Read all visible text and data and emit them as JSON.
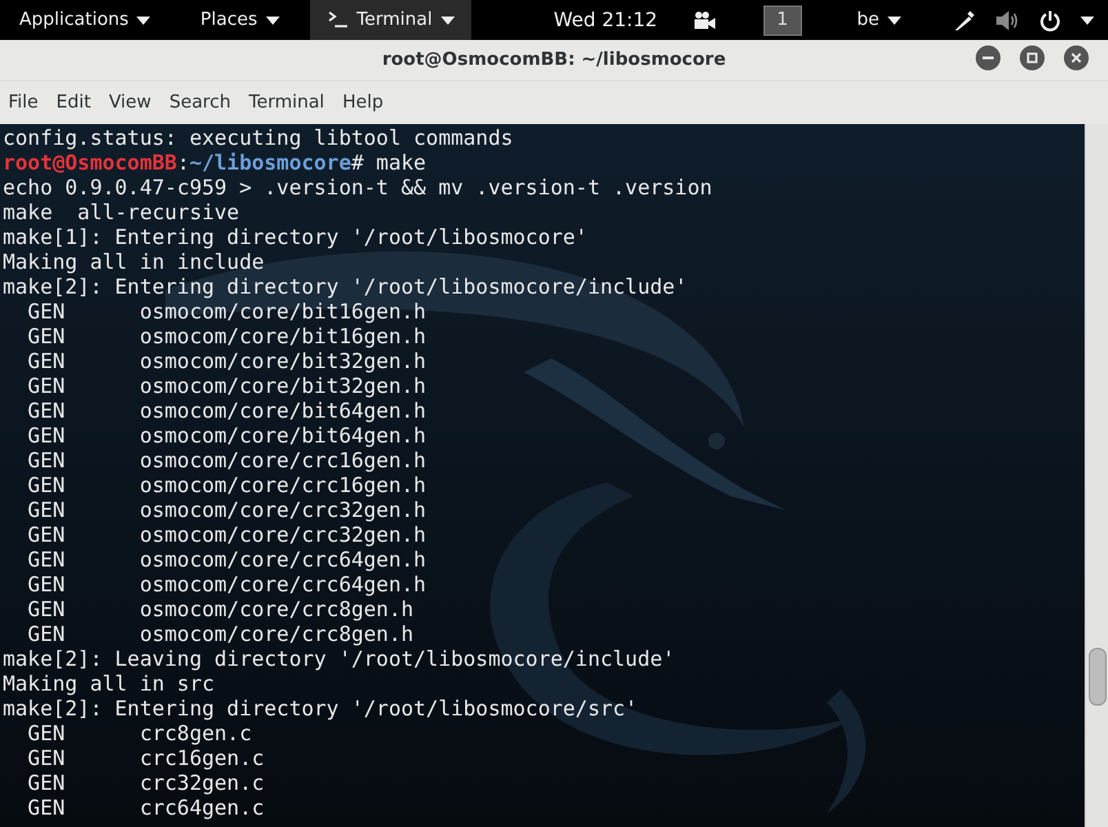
{
  "top_bar": {
    "menus": [
      {
        "label": "Applications",
        "kind": "menu"
      },
      {
        "label": "Places",
        "kind": "menu"
      },
      {
        "label": "Terminal",
        "kind": "app"
      }
    ],
    "clock": "Wed 21:12",
    "workspace": "1",
    "keyboard_layout": "be"
  },
  "window": {
    "title": "root@OsmocomBB: ~/libosmocore"
  },
  "menu_bar": [
    "File",
    "Edit",
    "View",
    "Search",
    "Terminal",
    "Help"
  ],
  "terminal": {
    "lines": [
      {
        "kind": "output",
        "text": "config.status: executing libtool commands"
      },
      {
        "kind": "prompt",
        "user": "root@OsmocomBB",
        "separator": ":",
        "path": "~/libosmocore",
        "command": "# make"
      },
      {
        "kind": "output",
        "text": "echo 0.9.0.47-c959 > .version-t && mv .version-t .version"
      },
      {
        "kind": "output",
        "text": "make  all-recursive"
      },
      {
        "kind": "output",
        "text": "make[1]: Entering directory '/root/libosmocore'"
      },
      {
        "kind": "output",
        "text": "Making all in include"
      },
      {
        "kind": "output",
        "text": "make[2]: Entering directory '/root/libosmocore/include'"
      },
      {
        "kind": "output",
        "text": "  GEN      osmocom/core/bit16gen.h"
      },
      {
        "kind": "output",
        "text": "  GEN      osmocom/core/bit16gen.h"
      },
      {
        "kind": "output",
        "text": "  GEN      osmocom/core/bit32gen.h"
      },
      {
        "kind": "output",
        "text": "  GEN      osmocom/core/bit32gen.h"
      },
      {
        "kind": "output",
        "text": "  GEN      osmocom/core/bit64gen.h"
      },
      {
        "kind": "output",
        "text": "  GEN      osmocom/core/bit64gen.h"
      },
      {
        "kind": "output",
        "text": "  GEN      osmocom/core/crc16gen.h"
      },
      {
        "kind": "output",
        "text": "  GEN      osmocom/core/crc16gen.h"
      },
      {
        "kind": "output",
        "text": "  GEN      osmocom/core/crc32gen.h"
      },
      {
        "kind": "output",
        "text": "  GEN      osmocom/core/crc32gen.h"
      },
      {
        "kind": "output",
        "text": "  GEN      osmocom/core/crc64gen.h"
      },
      {
        "kind": "output",
        "text": "  GEN      osmocom/core/crc64gen.h"
      },
      {
        "kind": "output",
        "text": "  GEN      osmocom/core/crc8gen.h"
      },
      {
        "kind": "output",
        "text": "  GEN      osmocom/core/crc8gen.h"
      },
      {
        "kind": "output",
        "text": "make[2]: Leaving directory '/root/libosmocore/include'"
      },
      {
        "kind": "output",
        "text": "Making all in src"
      },
      {
        "kind": "output",
        "text": "make[2]: Entering directory '/root/libosmocore/src'"
      },
      {
        "kind": "output",
        "text": "  GEN      crc8gen.c"
      },
      {
        "kind": "output",
        "text": "  GEN      crc16gen.c"
      },
      {
        "kind": "output",
        "text": "  GEN      crc32gen.c"
      },
      {
        "kind": "output",
        "text": "  GEN      crc64gen.c"
      }
    ]
  }
}
